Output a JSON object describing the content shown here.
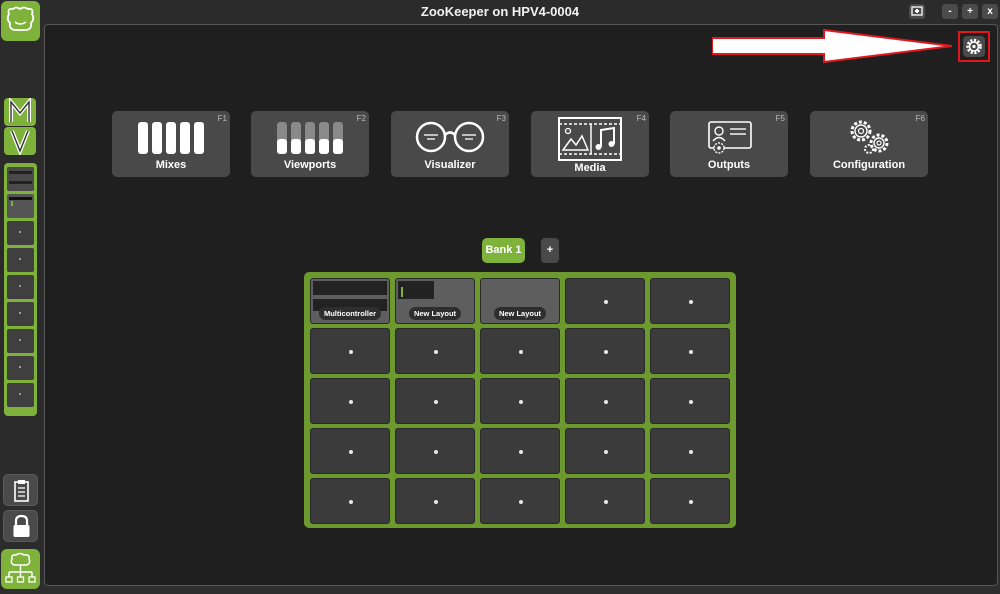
{
  "window": {
    "title": "ZooKeeper on HPV4-0004",
    "buttons": {
      "screenshot": "",
      "minimize": "-",
      "maximize": "+",
      "close": "x"
    }
  },
  "sidebar": {
    "top_logo": "zookeeper-logo",
    "mode_m": "M",
    "mode_v": "V",
    "slots": [
      "",
      "",
      "",
      "",
      "",
      "",
      "",
      "",
      ""
    ],
    "tools": [
      "clipboard-icon",
      "lock-icon"
    ],
    "bottom_logo": "network-tree-icon"
  },
  "colors": {
    "accent": "#7fb23a",
    "highlight": "#e0171f",
    "panel": "#494949",
    "background": "#1f1f1f"
  },
  "modes": [
    {
      "label": "Mixes",
      "fkey": "F1",
      "icon": "faders-icon"
    },
    {
      "label": "Viewports",
      "fkey": "F2",
      "icon": "faders-dim-icon"
    },
    {
      "label": "Visualizer",
      "fkey": "F3",
      "icon": "glasses-icon"
    },
    {
      "label": "Media",
      "fkey": "F4",
      "icon": "media-icon"
    },
    {
      "label": "Outputs",
      "fkey": "F5",
      "icon": "output-card-icon"
    },
    {
      "label": "Configuration",
      "fkey": "F6",
      "icon": "gears-icon"
    }
  ],
  "banks": {
    "active": "Bank 1",
    "add": "+"
  },
  "layouts": {
    "grid": [
      [
        "Multicontroller",
        "New Layout",
        "New Layout",
        "",
        ""
      ],
      [
        "",
        "",
        "",
        "",
        ""
      ],
      [
        "",
        "",
        "",
        "",
        ""
      ],
      [
        "",
        "",
        "",
        "",
        ""
      ],
      [
        "",
        "",
        "",
        "",
        ""
      ]
    ]
  }
}
